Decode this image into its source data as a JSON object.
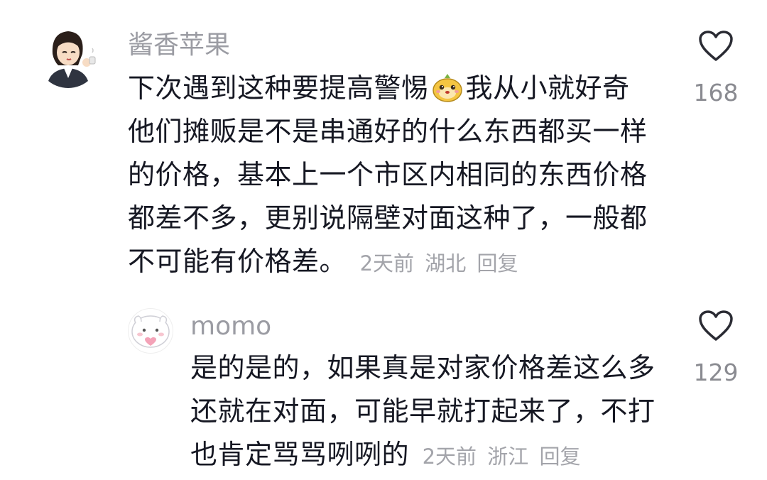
{
  "comments": [
    {
      "username": "酱香苹果",
      "text_before": "下次遇到这种要提高警惕",
      "emoji": "mascot-face-emoji",
      "text_after": "我从小就好奇他们摊贩是不是串通好的什么东西都买一样的价格，基本上一个市区内相同的东西价格都差不多，更别说隔壁对面这种了，一般都不可能有价格差。",
      "time": "2天前",
      "location": "湖北",
      "reply_label": "回复",
      "likes": "168"
    },
    {
      "username": "momo",
      "text": "是的是的，如果真是对家价格差这么多还就在对面，可能早就打起来了，不打也肯定骂骂咧咧的",
      "time": "2天前",
      "location": "浙江",
      "reply_label": "回复",
      "likes": "129"
    }
  ]
}
